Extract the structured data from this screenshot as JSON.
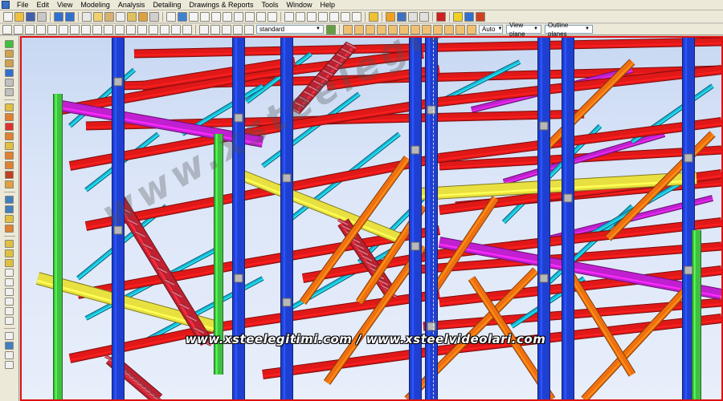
{
  "menu": {
    "items": [
      "File",
      "Edit",
      "View",
      "Modeling",
      "Analysis",
      "Detailing",
      "Drawings & Reports",
      "Tools",
      "Window",
      "Help"
    ]
  },
  "toolbar2": {
    "filter_value": "standard",
    "auto_value": "Auto",
    "view_plane_value": "View plane",
    "outline_value": "Outline planes"
  },
  "watermark": {
    "diagonal": "www.xsteelegitimi.com",
    "footer": "www.xsteelegitimi.com / www.xsteelvideolari.com"
  },
  "colors": {
    "column": "#1f3fd0",
    "beam": "#e01818",
    "brace": "#1ab8d8",
    "diagonal": "#f07010",
    "green_column": "#40c040",
    "purple_beam": "#c020d0",
    "yellow_beam": "#e8e040",
    "stair": "#c02030",
    "highlight_border": "#e01010"
  }
}
